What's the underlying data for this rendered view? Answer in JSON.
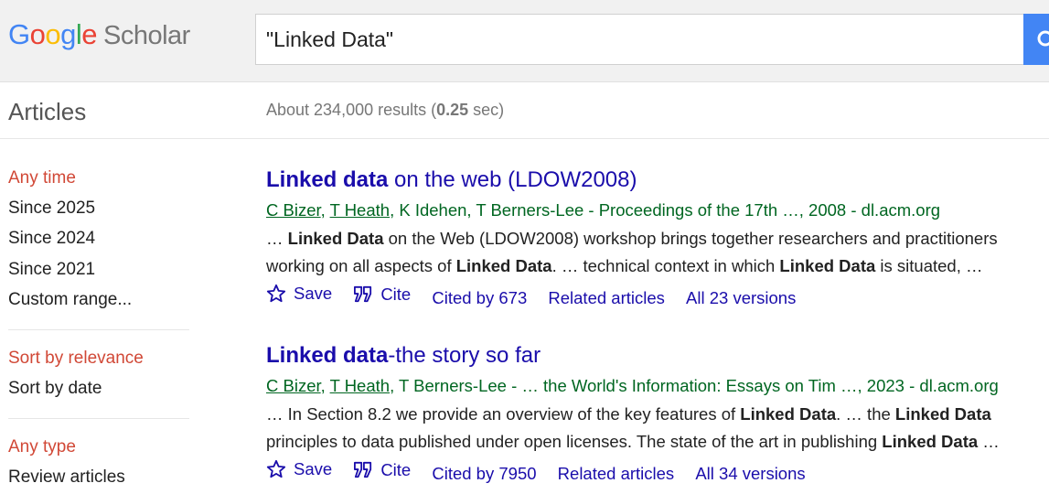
{
  "header": {
    "logo_letters": [
      "G",
      "o",
      "o",
      "g",
      "l",
      "e"
    ],
    "logo_product": "Scholar",
    "search_query": "\"Linked Data\""
  },
  "subbar": {
    "section_title": "Articles",
    "results_prefix": "About 234,000 results (",
    "results_time": "0.25",
    "results_suffix": " sec)"
  },
  "sidebar": {
    "time_filters": [
      "Any time",
      "Since 2025",
      "Since 2024",
      "Since 2021",
      "Custom range..."
    ],
    "sort_options": [
      "Sort by relevance",
      "Sort by date"
    ],
    "type_filters": [
      "Any type",
      "Review articles"
    ]
  },
  "results": [
    {
      "title_bold": "Linked data",
      "title_rest": " on the web (LDOW2008)",
      "authors": [
        "C Bizer",
        "T Heath"
      ],
      "authors_plain": ", K Idehen, T Berners-Lee",
      "source": " - Proceedings of the 17th …, 2008 - dl.acm.org",
      "snippet_line1": [
        "… ",
        "Linked Data",
        " on the Web (LDOW2008) workshop brings together researchers and practitioners"
      ],
      "snippet_line2": [
        "working on all aspects of ",
        "Linked Data",
        ". … technical context in which ",
        "Linked Data",
        " is situated, …"
      ],
      "save": "Save",
      "cite": "Cite",
      "cited_by": "Cited by 673",
      "related": "Related articles",
      "versions": "All 23 versions"
    },
    {
      "title_bold": "Linked data",
      "title_rest": "-the story so far",
      "authors": [
        "C Bizer",
        "T Heath"
      ],
      "authors_plain": ", T Berners-Lee",
      "source": " - … the World's Information: Essays on Tim …, 2023 - dl.acm.org",
      "snippet_line1": [
        "… In Section 8.2 we provide an overview of the key features of ",
        "Linked Data",
        ". … the ",
        "Linked Data",
        ""
      ],
      "snippet_line2": [
        "principles to data published under open licenses. The state of the art in publishing ",
        "Linked Data",
        " …"
      ],
      "save": "Save",
      "cite": "Cite",
      "cited_by": "Cited by 7950",
      "related": "Related articles",
      "versions": "All 34 versions"
    }
  ],
  "colors": {
    "link": "#1a0dab",
    "author_green": "#006621",
    "active_filter": "#d14836",
    "search_button": "#4285f4"
  }
}
